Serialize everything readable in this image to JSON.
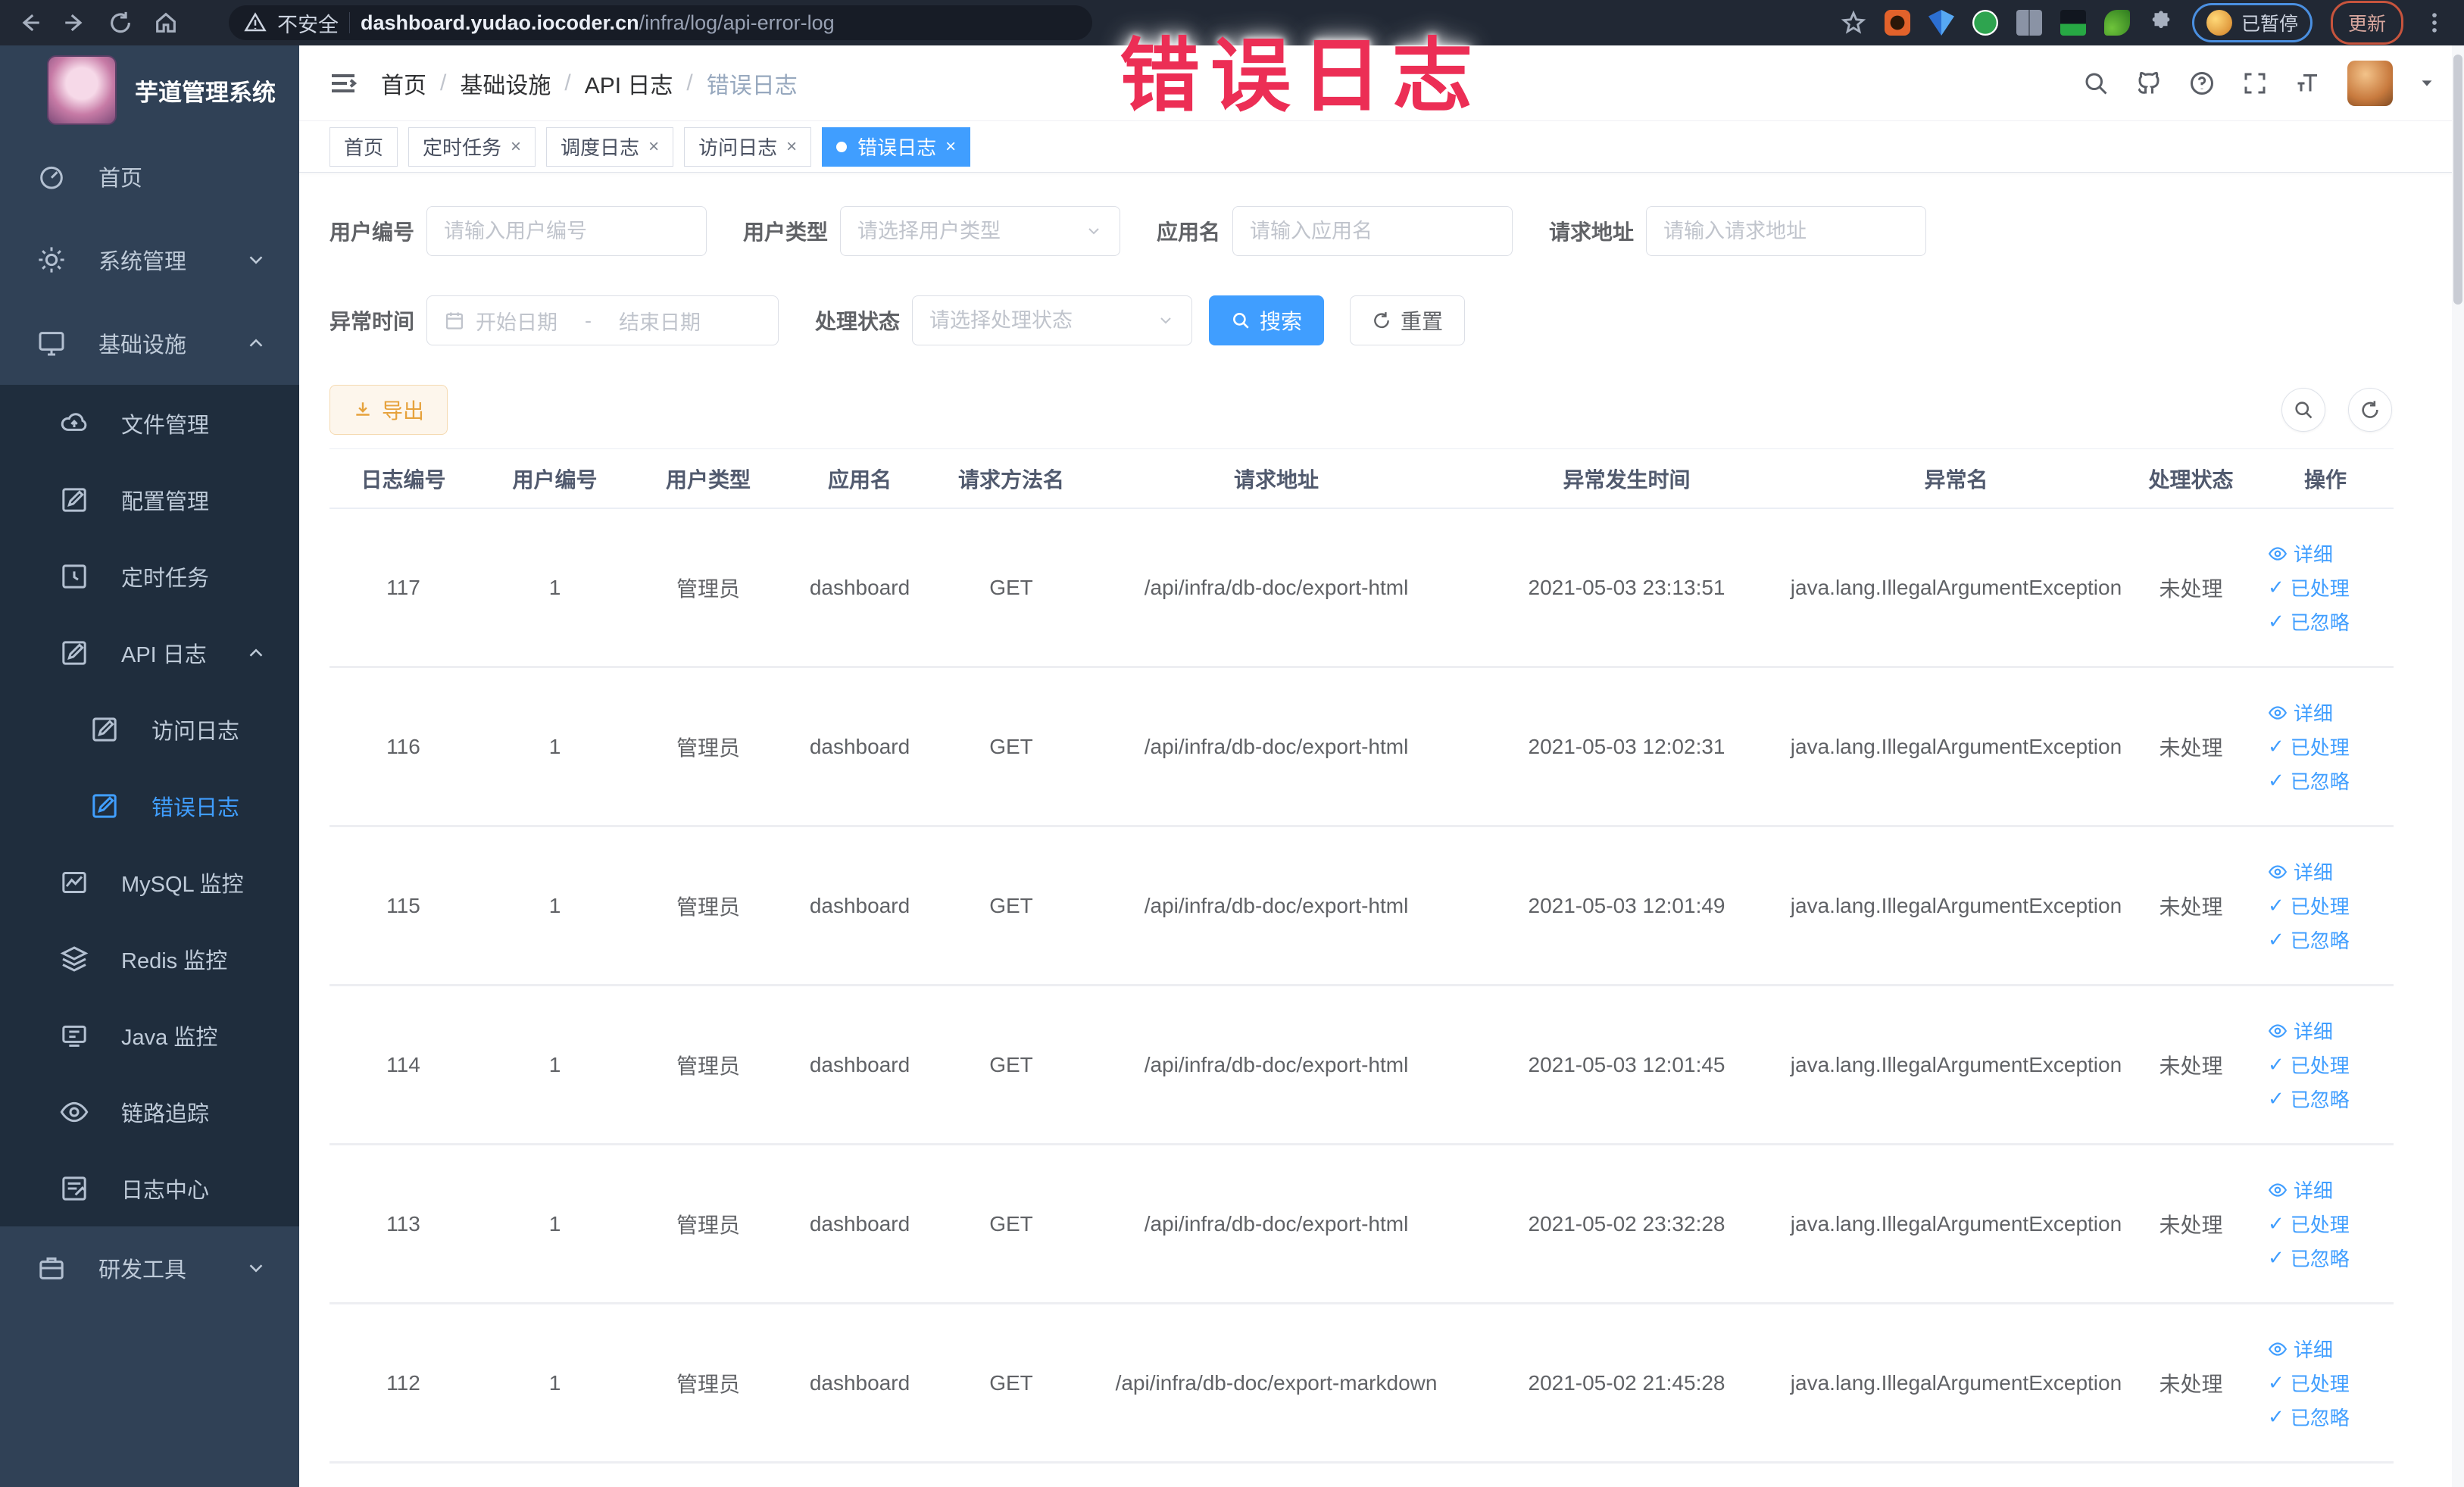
{
  "watermark": "错误日志",
  "icons": {
    "check": "✓",
    "close": "×"
  },
  "colors": {
    "accent": "#409eff",
    "warning": "#e6a23c",
    "watermark": "#ec2e55",
    "sidebar_bg": "#304156",
    "submenu_bg": "#1f2d3d",
    "browser_bg": "#212834"
  },
  "browser": {
    "security_label": "不安全",
    "url_host": "dashboard.yudao.iocoder.cn",
    "url_path": "/infra/log/api-error-log",
    "paused_chip": "已暂停",
    "update_chip": "更新"
  },
  "sidebar": {
    "app_title": "芋道管理系统",
    "items": [
      {
        "label": "首页"
      },
      {
        "label": "系统管理"
      },
      {
        "label": "基础设施"
      },
      {
        "label": "文件管理"
      },
      {
        "label": "配置管理"
      },
      {
        "label": "定时任务"
      },
      {
        "label": "API 日志"
      },
      {
        "label": "访问日志"
      },
      {
        "label": "错误日志"
      },
      {
        "label": "MySQL 监控"
      },
      {
        "label": "Redis 监控"
      },
      {
        "label": "Java 监控"
      },
      {
        "label": "链路追踪"
      },
      {
        "label": "日志中心"
      },
      {
        "label": "研发工具"
      }
    ]
  },
  "header": {
    "breadcrumb": [
      "首页",
      "基础设施",
      "API 日志",
      "错误日志"
    ]
  },
  "tags": [
    {
      "label": "首页",
      "closable": false,
      "active": false
    },
    {
      "label": "定时任务",
      "closable": true,
      "active": false
    },
    {
      "label": "调度日志",
      "closable": true,
      "active": false
    },
    {
      "label": "访问日志",
      "closable": true,
      "active": false
    },
    {
      "label": "错误日志",
      "closable": true,
      "active": true
    }
  ],
  "filters": {
    "user_id": {
      "label": "用户编号",
      "placeholder": "请输入用户编号"
    },
    "user_type": {
      "label": "用户类型",
      "placeholder": "请选择用户类型"
    },
    "app_name": {
      "label": "应用名",
      "placeholder": "请输入应用名"
    },
    "request_url": {
      "label": "请求地址",
      "placeholder": "请输入请求地址"
    },
    "exception_time": {
      "label": "异常时间",
      "start_placeholder": "开始日期",
      "end_placeholder": "结束日期",
      "separator": "-"
    },
    "process_status": {
      "label": "处理状态",
      "placeholder": "请选择处理状态"
    },
    "search_label": "搜索",
    "reset_label": "重置"
  },
  "toolbar": {
    "export_label": "导出"
  },
  "table": {
    "columns": [
      "日志编号",
      "用户编号",
      "用户类型",
      "应用名",
      "请求方法名",
      "请求地址",
      "异常发生时间",
      "异常名",
      "处理状态",
      "操作"
    ],
    "actions": [
      "详细",
      "已处理",
      "已忽略"
    ],
    "rows": [
      {
        "id": "117",
        "user_id": "1",
        "user_type": "管理员",
        "app": "dashboard",
        "method": "GET",
        "url": "/api/infra/db-doc/export-html",
        "time": "2021-05-03 23:13:51",
        "exception": "java.lang.IllegalArgumentException",
        "status": "未处理"
      },
      {
        "id": "116",
        "user_id": "1",
        "user_type": "管理员",
        "app": "dashboard",
        "method": "GET",
        "url": "/api/infra/db-doc/export-html",
        "time": "2021-05-03 12:02:31",
        "exception": "java.lang.IllegalArgumentException",
        "status": "未处理"
      },
      {
        "id": "115",
        "user_id": "1",
        "user_type": "管理员",
        "app": "dashboard",
        "method": "GET",
        "url": "/api/infra/db-doc/export-html",
        "time": "2021-05-03 12:01:49",
        "exception": "java.lang.IllegalArgumentException",
        "status": "未处理"
      },
      {
        "id": "114",
        "user_id": "1",
        "user_type": "管理员",
        "app": "dashboard",
        "method": "GET",
        "url": "/api/infra/db-doc/export-html",
        "time": "2021-05-03 12:01:45",
        "exception": "java.lang.IllegalArgumentException",
        "status": "未处理"
      },
      {
        "id": "113",
        "user_id": "1",
        "user_type": "管理员",
        "app": "dashboard",
        "method": "GET",
        "url": "/api/infra/db-doc/export-html",
        "time": "2021-05-02 23:32:28",
        "exception": "java.lang.IllegalArgumentException",
        "status": "未处理"
      },
      {
        "id": "112",
        "user_id": "1",
        "user_type": "管理员",
        "app": "dashboard",
        "method": "GET",
        "url": "/api/infra/db-doc/export-markdown",
        "time": "2021-05-02 21:45:28",
        "exception": "java.lang.IllegalArgumentException",
        "status": "未处理"
      }
    ]
  }
}
